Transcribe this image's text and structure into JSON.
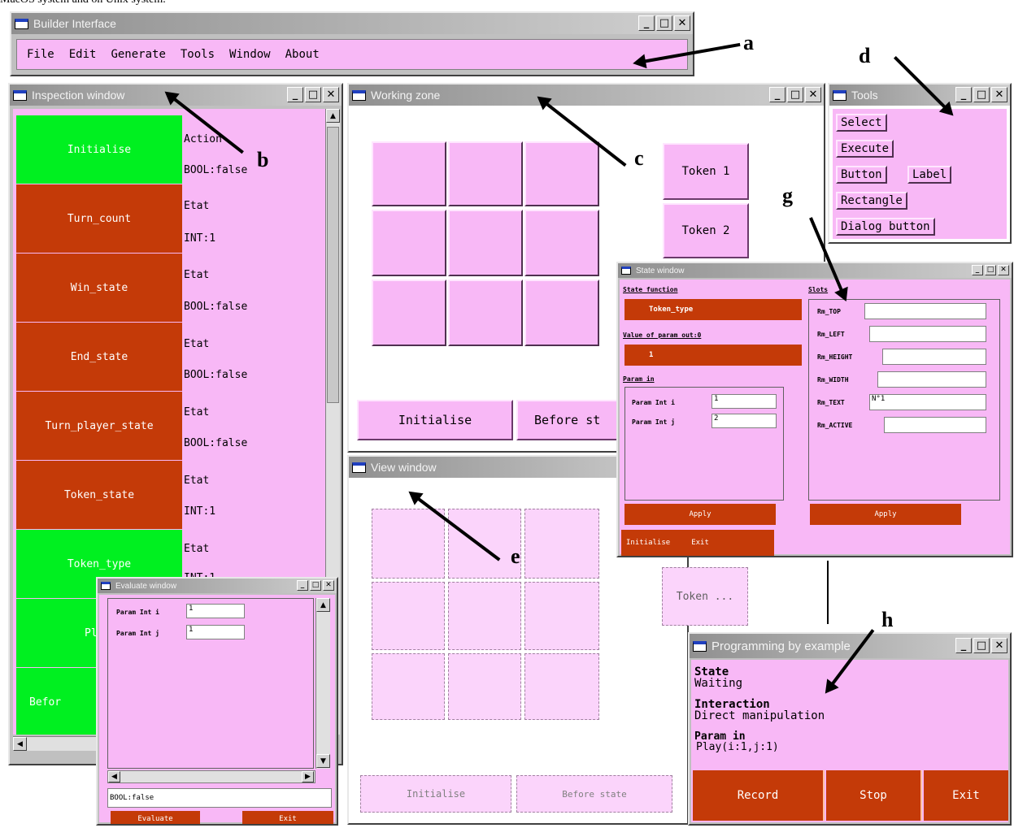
{
  "caption": "MacOS system and on Unix system.",
  "builder": {
    "title": "Builder Interface",
    "menu": [
      "File",
      "Edit",
      "Generate",
      "Tools",
      "Window",
      "About"
    ]
  },
  "inspection": {
    "title": "Inspection window",
    "items": [
      {
        "name": "Initialise",
        "color": "green",
        "type": "Action",
        "value": "BOOL:false"
      },
      {
        "name": "Turn_count",
        "color": "red",
        "type": "Etat",
        "value": "INT:1"
      },
      {
        "name": "Win_state",
        "color": "red",
        "type": "Etat",
        "value": "BOOL:false"
      },
      {
        "name": "End_state",
        "color": "red",
        "type": "Etat",
        "value": "BOOL:false"
      },
      {
        "name": "Turn_player_state",
        "color": "red",
        "type": "Etat",
        "value": "BOOL:false"
      },
      {
        "name": "Token_state",
        "color": "red",
        "type": "Etat",
        "value": "INT:1"
      },
      {
        "name": "Token_type",
        "color": "green",
        "type": "Etat",
        "value": "INT:1"
      },
      {
        "name": "Pl",
        "color": "green",
        "type": "",
        "value": ""
      },
      {
        "name": "Befor",
        "color": "green",
        "type": "",
        "value": ""
      }
    ]
  },
  "working": {
    "title": "Working zone",
    "tokens": [
      "Token 1",
      "Token 2"
    ],
    "buttons": [
      "Initialise",
      "Before st"
    ]
  },
  "tools": {
    "title": "Tools",
    "items": [
      "Select",
      "Execute",
      "Button",
      "Label",
      "Rectangle",
      "Dialog button"
    ]
  },
  "state": {
    "title": "State window",
    "state_function_label": "State function",
    "state_function_value": "Token_type",
    "param_out_label": "Value of param out:0",
    "param_out_value": "1",
    "param_in_label": "Param in",
    "params": [
      {
        "label": "Param Int i",
        "value": "1"
      },
      {
        "label": "Param Int j",
        "value": "2"
      }
    ],
    "slots_label": "Slots",
    "slots": [
      "Rm_TOP",
      "Rm_LEFT",
      "Rm_HEIGHT",
      "Rm_WIDTH",
      "Rm_TEXT",
      "Rm_ACTIVE"
    ],
    "slot_text_value": "N°1",
    "apply": "Apply",
    "bottom": [
      "Initialise",
      "Exit"
    ]
  },
  "view": {
    "title": "View window",
    "token": "Token ...",
    "buttons": [
      "Initialise",
      "Before state"
    ]
  },
  "evaluate": {
    "title": "Evaluate window",
    "params": [
      {
        "label": "Param Int i",
        "value": "1"
      },
      {
        "label": "Param Int j",
        "value": "1"
      }
    ],
    "result": "BOOL:false",
    "buttons": [
      "Evaluate",
      "Exit"
    ]
  },
  "programming": {
    "title": "Programming by example",
    "state_label": "State",
    "state_value": "Waiting",
    "interaction_label": "Interaction",
    "interaction_value": "Direct manipulation",
    "param_label": "Param in",
    "param_value": "Play(i:1,j:1)",
    "buttons": [
      "Record",
      "Stop",
      "Exit"
    ]
  },
  "labels": [
    "a",
    "b",
    "c",
    "d",
    "e",
    "g",
    "h"
  ]
}
